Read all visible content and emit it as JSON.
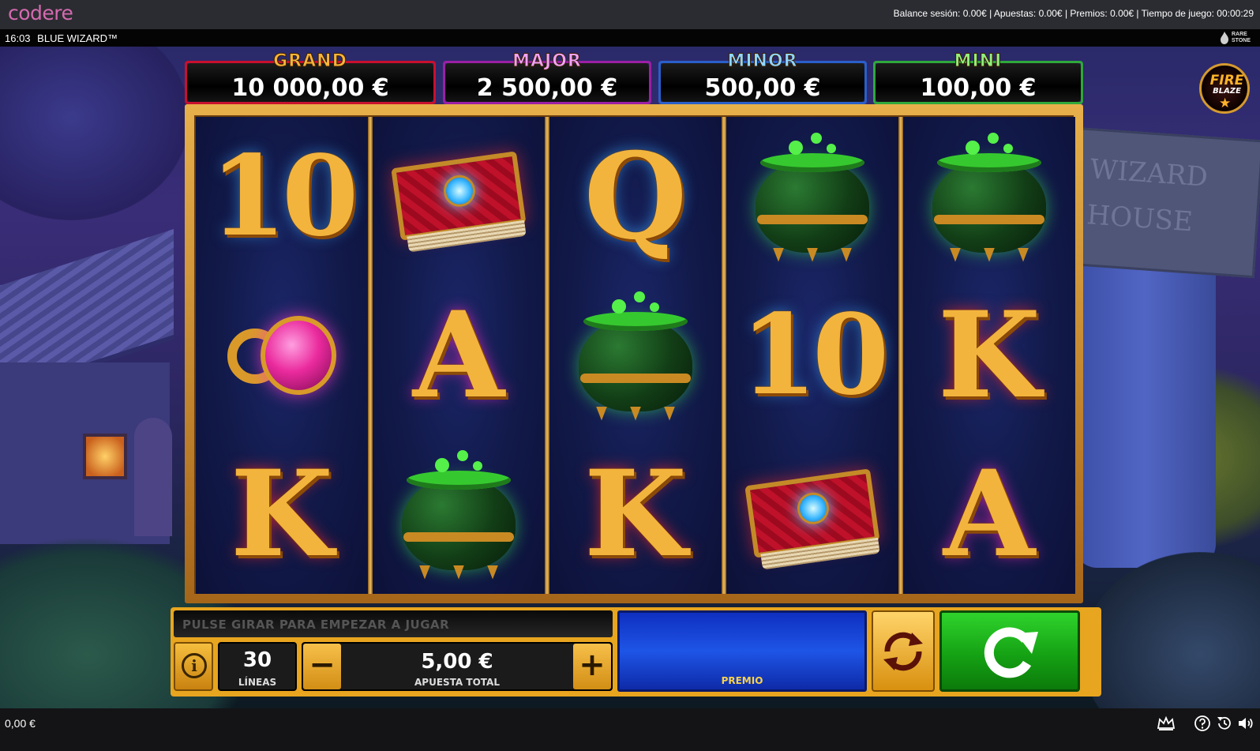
{
  "brand": {
    "logo_text": "codere"
  },
  "session": {
    "text": "Balance sesión: 0.00€ | Apuestas: 0.00€ | Premios: 0.00€ | Tiempo de juego: 00:00:29"
  },
  "titlebar": {
    "time": "16:03",
    "game_title": "BLUE WIZARD™",
    "provider": "RARE STONE"
  },
  "background": {
    "sign_line1": "WIZARD",
    "sign_line2": "HOUSE"
  },
  "jackpots": [
    {
      "name": "GRAND",
      "value": "10 000,00 €",
      "color": "#c8102e"
    },
    {
      "name": "MAJOR",
      "value": "2 500,00 €",
      "color": "#9b1fa5"
    },
    {
      "name": "MINOR",
      "value": "500,00 €",
      "color": "#2a5fc9"
    },
    {
      "name": "MINI",
      "value": "100,00 €",
      "color": "#2fa83b"
    }
  ],
  "badge": {
    "line1": "FIRE",
    "line2": "BLAZE"
  },
  "reels": [
    [
      "10",
      "ring",
      "K"
    ],
    [
      "book",
      "A",
      "cauldron"
    ],
    [
      "Q",
      "cauldron",
      "K"
    ],
    [
      "cauldron",
      "10",
      "book"
    ],
    [
      "cauldron",
      "K",
      "A"
    ]
  ],
  "controls": {
    "message": "PULSE GIRAR PARA EMPEZAR A JUGAR",
    "lines_value": "30",
    "lines_label": "LÍNEAS",
    "minus_label": "−",
    "plus_label": "+",
    "bet_value": "5,00 €",
    "bet_label": "APUESTA TOTAL",
    "win_label": "PREMIO",
    "info_label": "i"
  },
  "footer": {
    "balance": "0,00 €",
    "icons": [
      "crown-icon",
      "help-icon",
      "history-icon",
      "sound-icon"
    ]
  },
  "colors": {
    "brand": "#d46ab0",
    "panel": "#e8a51f",
    "spin": "#15a214",
    "win_box": "#1e55e6"
  }
}
